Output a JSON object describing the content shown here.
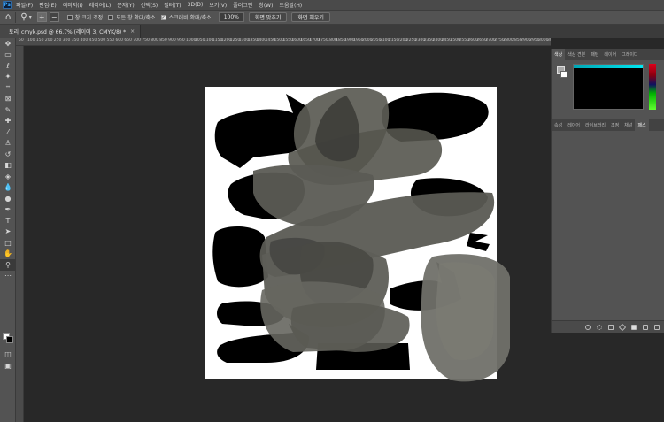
{
  "app": {
    "logo": "Ps"
  },
  "menu": [
    "파일(F)",
    "편집(E)",
    "이미지(I)",
    "레이어(L)",
    "문자(Y)",
    "선택(S)",
    "필터(T)",
    "3D(D)",
    "보기(V)",
    "플러그인",
    "창(W)",
    "도움말(H)"
  ],
  "options": {
    "zoom_percent": "100%",
    "checks": [
      {
        "label": "창 크기 조정",
        "checked": false
      },
      {
        "label": "모든 창 확대/축소",
        "checked": false
      },
      {
        "label": "스크러비 확대/축소",
        "checked": true
      }
    ],
    "fit_button": "화면 맞추기",
    "fill_button": "화면 채우기"
  },
  "document_tab": {
    "title": "토리_cmyk.psd @ 66.7% (레이어 3, CMYK/8) *",
    "close": "×"
  },
  "ruler_ticks": [
    "50",
    "100",
    "150",
    "200",
    "250",
    "300",
    "350",
    "400",
    "450",
    "500",
    "550",
    "600",
    "650",
    "700",
    "750",
    "800",
    "850",
    "900",
    "950",
    "1000",
    "1050",
    "1100",
    "1150",
    "1200",
    "1250",
    "1300",
    "1350",
    "1400",
    "1450",
    "1500",
    "1550",
    "1600",
    "1650",
    "1700",
    "1750",
    "1800",
    "1850",
    "1900",
    "1950",
    "2000",
    "2050",
    "2100",
    "2150",
    "2200",
    "2250",
    "2300",
    "2350",
    "2400",
    "2450",
    "2500",
    "2550",
    "2600",
    "2650",
    "2700",
    "2750",
    "2800",
    "2850",
    "2900",
    "2950",
    "3000",
    "3050"
  ],
  "panel_top_tabs": [
    "색상",
    "색상 견본",
    "패턴",
    "레이어",
    "그레이디"
  ],
  "panel_bottom_tabs": [
    "속성",
    "레이어",
    "라이브러리",
    "조정",
    "채널",
    "패스"
  ],
  "colors": {
    "accent": "#00d8e6",
    "workspace": "#282828",
    "panel": "#535353"
  }
}
